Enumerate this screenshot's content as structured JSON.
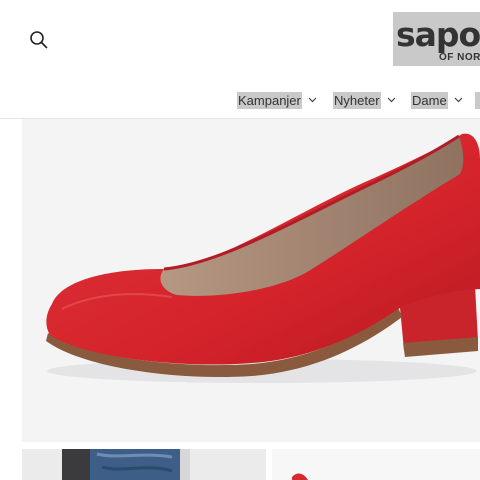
{
  "header": {
    "search_icon": "search-icon",
    "logo": {
      "main_text": "sapo",
      "sub_text": "OF NOR"
    }
  },
  "nav": {
    "items": [
      {
        "label": "Kampanjer",
        "icon": "chevron-down-icon"
      },
      {
        "label": "Nyheter",
        "icon": "chevron-down-icon"
      },
      {
        "label": "Dame",
        "icon": "chevron-down-icon"
      }
    ]
  },
  "colors": {
    "shoe_red": "#d8232b",
    "logo_bg": "#c9c9c9",
    "hero_bg": "#f4f4f5"
  }
}
